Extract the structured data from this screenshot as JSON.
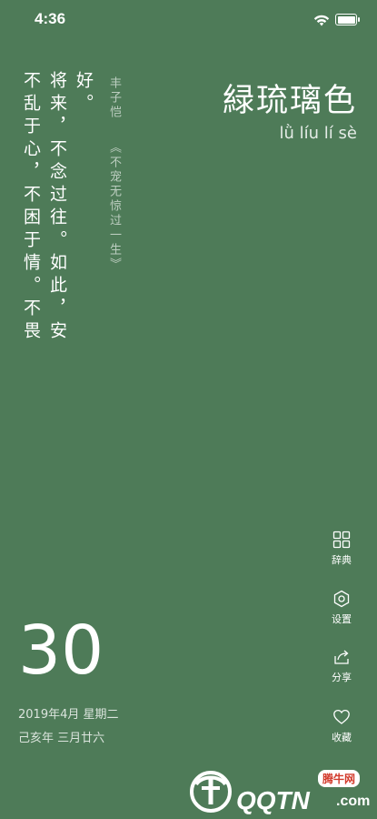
{
  "status_bar": {
    "time": "4:36"
  },
  "poem": {
    "columns": [
      "好。",
      "将来，不念过往。如此，安",
      "不乱于心，不困于情。不畏"
    ],
    "author": "丰子恺",
    "source": "《不宠无惊过一生》"
  },
  "color": {
    "name": "緑琉璃色",
    "pinyin": "lǜ líu lí sè",
    "background": "#4e7b58"
  },
  "side_menu": {
    "dictionary": "辞典",
    "settings": "设置",
    "share": "分享",
    "favorite": "收藏"
  },
  "date": {
    "day": "30",
    "line1": "2019年4月 星期二",
    "line2": "己亥年 三月廿六"
  },
  "watermark": {
    "brand": "QQTN",
    "suffix": ".com",
    "tag": "腾牛网"
  }
}
